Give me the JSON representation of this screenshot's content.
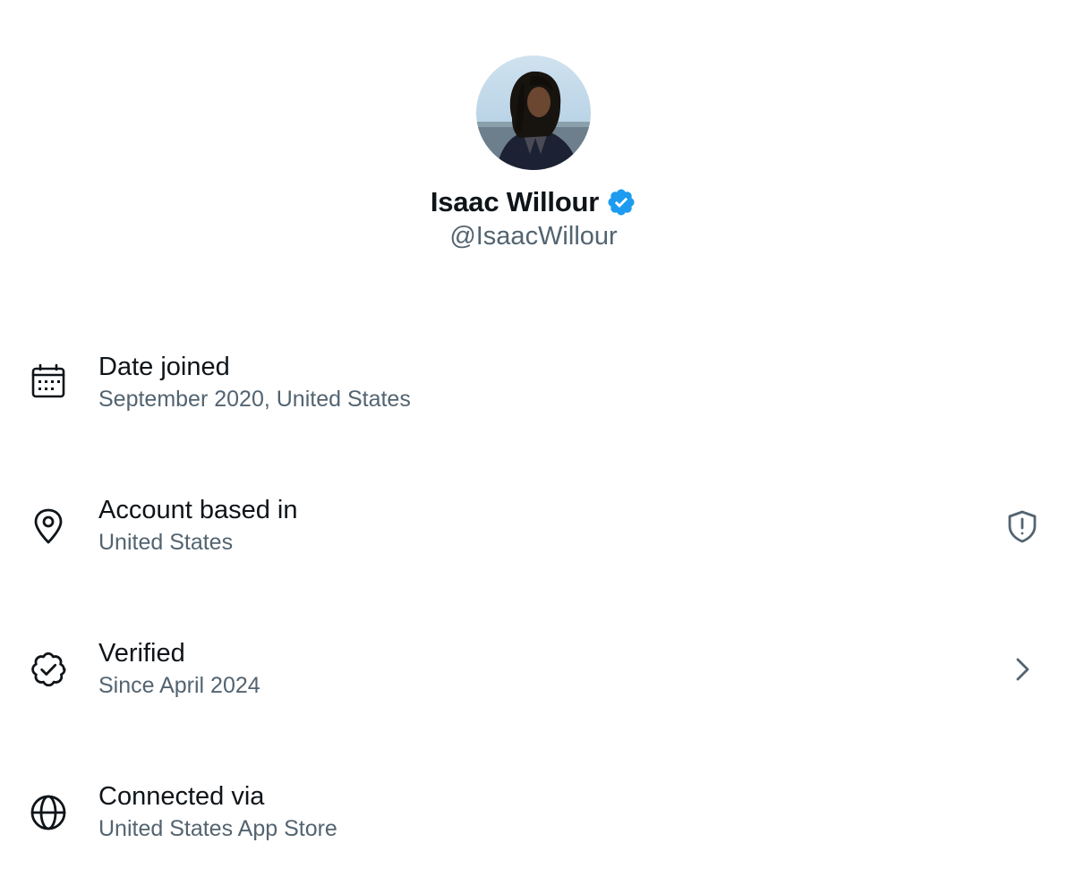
{
  "profile": {
    "display_name": "Isaac Willour",
    "handle": "@IsaacWillour",
    "verified_badge_color": "#1d9bf0"
  },
  "rows": [
    {
      "title": "Date joined",
      "subtitle": "September 2020, United States",
      "icon": "calendar-icon"
    },
    {
      "title": "Account based in",
      "subtitle": "United States",
      "icon": "location-pin-icon",
      "trailing_icon": "shield-alert-icon"
    },
    {
      "title": "Verified",
      "subtitle": "Since April 2024",
      "icon": "verified-badge-outline-icon",
      "trailing_icon": "chevron-right-icon"
    },
    {
      "title": "Connected via",
      "subtitle": "United States App Store",
      "icon": "globe-icon"
    }
  ],
  "colors": {
    "primary_text": "#0f1419",
    "secondary_text": "#536471",
    "background": "#ffffff"
  }
}
